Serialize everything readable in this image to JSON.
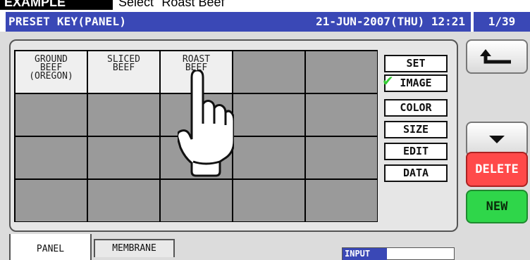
{
  "example": {
    "tag": "EXAMPLE",
    "text": "Select \"Roast Beef\""
  },
  "header": {
    "title": "PRESET KEY(PANEL)",
    "datetime": "21-JUN-2007(THU) 12:21",
    "page": "1/39"
  },
  "grid": {
    "keys": [
      "GROUND\nBEEF\n(OREGON)",
      "SLICED\nBEEF",
      "ROAST\nBEEF",
      "",
      "",
      "",
      "",
      "",
      "",
      "",
      "",
      "",
      "",
      "",
      "",
      "",
      "",
      "",
      "",
      ""
    ],
    "filled_color": "#efefef",
    "empty_color": "#9a9a9a"
  },
  "side_buttons": {
    "set": "SET",
    "image": "IMAGE",
    "color": "COLOR",
    "size": "SIZE",
    "edit": "EDIT",
    "data": "DATA",
    "checked": "IMAGE"
  },
  "right_buttons": {
    "back_icon": "back-arrow-icon",
    "down_icon": "down-triangle-icon",
    "delete": "DELETE",
    "new": "NEW"
  },
  "tabs": {
    "panel": "PANEL",
    "membrane": "MEMBRANE"
  },
  "input": {
    "label": "INPUT",
    "value": ""
  },
  "colors": {
    "title_bar": "#3a48b6",
    "delete": "#ff4a4a",
    "new": "#2fd64a",
    "check": "#33cc33"
  }
}
